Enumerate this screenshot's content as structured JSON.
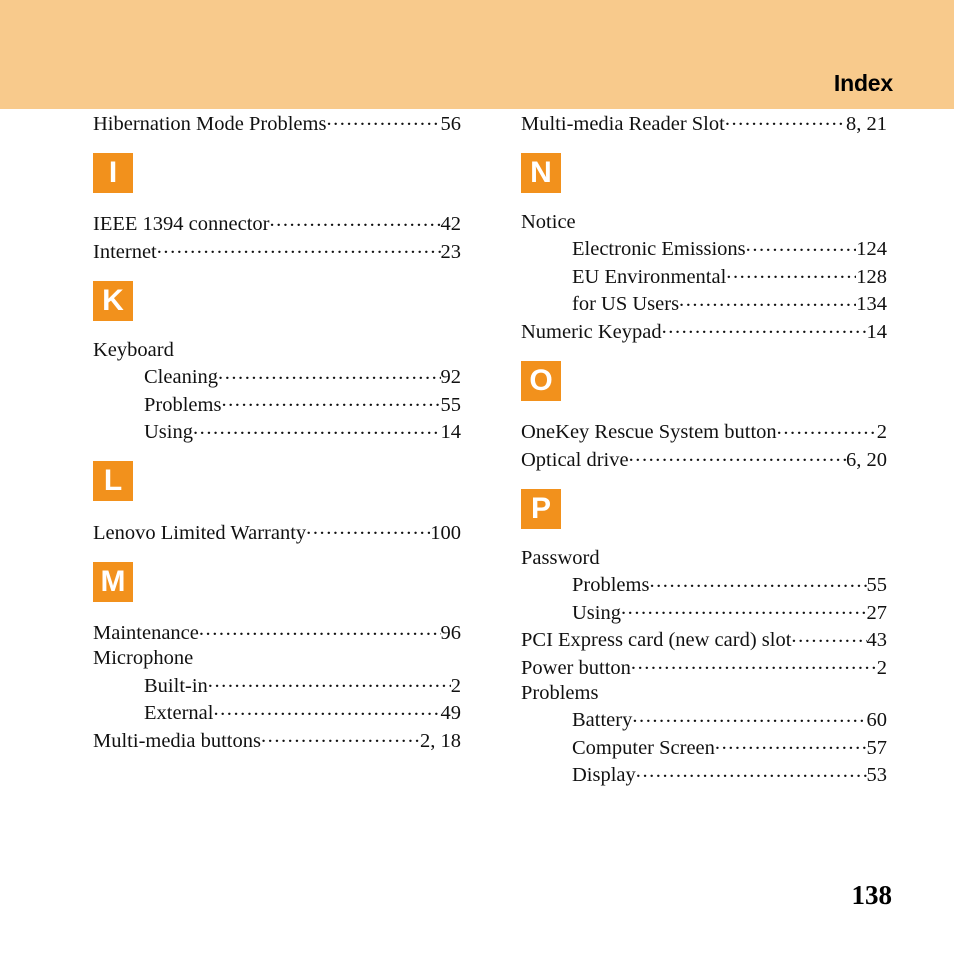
{
  "header": {
    "title": "Index",
    "banner_color": "#f8ca8c"
  },
  "letter_box_color": "#f2911c",
  "page_number": "138",
  "columns": [
    {
      "id": "left",
      "blocks": [
        {
          "type": "entries",
          "entries": [
            {
              "term": "Hibernation Mode Problems",
              "pages": "56",
              "level": 0
            }
          ]
        },
        {
          "type": "letter",
          "letter": "I"
        },
        {
          "type": "entries",
          "entries": [
            {
              "term": "IEEE 1394 connector",
              "pages": "42",
              "level": 0
            },
            {
              "term": "Internet",
              "pages": "23",
              "level": 0
            }
          ]
        },
        {
          "type": "letter",
          "letter": "K"
        },
        {
          "type": "entries",
          "entries": [
            {
              "term": "Keyboard",
              "pages": "",
              "level": 0
            },
            {
              "term": "Cleaning",
              "pages": "92",
              "level": 1
            },
            {
              "term": "Problems",
              "pages": "55",
              "level": 1
            },
            {
              "term": "Using",
              "pages": "14",
              "level": 1
            }
          ]
        },
        {
          "type": "letter",
          "letter": "L"
        },
        {
          "type": "entries",
          "entries": [
            {
              "term": "Lenovo Limited Warranty",
              "pages": "100",
              "level": 0
            }
          ]
        },
        {
          "type": "letter",
          "letter": "M"
        },
        {
          "type": "entries",
          "entries": [
            {
              "term": "Maintenance",
              "pages": "96",
              "level": 0
            },
            {
              "term": "Microphone",
              "pages": "",
              "level": 0
            },
            {
              "term": "Built-in",
              "pages": "2",
              "level": 1
            },
            {
              "term": "External",
              "pages": "49",
              "level": 1
            },
            {
              "term": "Multi-media buttons",
              "pages": "2, 18",
              "level": 0
            }
          ]
        }
      ]
    },
    {
      "id": "right",
      "blocks": [
        {
          "type": "entries",
          "entries": [
            {
              "term": "Multi-media Reader Slot",
              "pages": "8, 21",
              "level": 0
            }
          ]
        },
        {
          "type": "letter",
          "letter": "N"
        },
        {
          "type": "entries",
          "entries": [
            {
              "term": "Notice",
              "pages": "",
              "level": 0
            },
            {
              "term": "Electronic Emissions",
              "pages": "124",
              "level": 1
            },
            {
              "term": "EU Environmental",
              "pages": "128",
              "level": 1
            },
            {
              "term": "for US Users",
              "pages": "134",
              "level": 1
            },
            {
              "term": "Numeric Keypad",
              "pages": "14",
              "level": 0
            }
          ]
        },
        {
          "type": "letter",
          "letter": "O"
        },
        {
          "type": "entries",
          "entries": [
            {
              "term": "OneKey Rescue System button",
              "pages": "2",
              "level": 0
            },
            {
              "term": "Optical drive",
              "pages": "6, 20",
              "level": 0
            }
          ]
        },
        {
          "type": "letter",
          "letter": "P"
        },
        {
          "type": "entries",
          "entries": [
            {
              "term": "Password",
              "pages": "",
              "level": 0
            },
            {
              "term": "Problems",
              "pages": "55",
              "level": 1
            },
            {
              "term": "Using",
              "pages": "27",
              "level": 1
            },
            {
              "term": "PCI Express card (new card) slot",
              "pages": "43",
              "level": 0
            },
            {
              "term": "Power button",
              "pages": "2",
              "level": 0
            },
            {
              "term": "Problems",
              "pages": "",
              "level": 0
            },
            {
              "term": "Battery",
              "pages": "60",
              "level": 1
            },
            {
              "term": "Computer Screen",
              "pages": "57",
              "level": 1
            },
            {
              "term": "Display",
              "pages": "53",
              "level": 1
            }
          ]
        }
      ]
    }
  ]
}
